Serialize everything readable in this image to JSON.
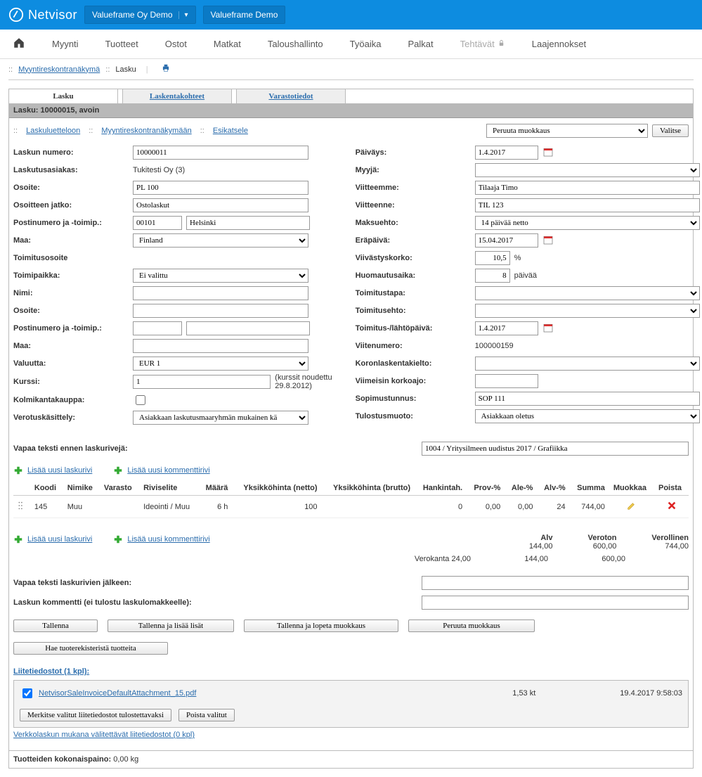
{
  "header": {
    "brand": "Netvisor",
    "company": "Valueframe Oy Demo",
    "env": "Valueframe Demo"
  },
  "menu": {
    "items": [
      "Myynti",
      "Tuotteet",
      "Ostot",
      "Matkat",
      "Taloushallinto",
      "Työaika",
      "Palkat",
      "Tehtävät",
      "Laajennokset"
    ]
  },
  "breadcrumb": {
    "link1": "Myyntireskontranäkymä",
    "sep": "::",
    "current": "Lasku"
  },
  "tabs": {
    "t1": "Lasku",
    "t2": "Laskentakohteet",
    "t3": "Varastotiedot"
  },
  "title": "Lasku: 10000015, avoin",
  "links": {
    "l1": "Laskuluetteloon",
    "l2": "Myyntireskontranäkymään",
    "l3": "Esikatsele"
  },
  "actions": {
    "select_default": "Peruuta muokkaus",
    "valitse": "Valitse"
  },
  "left": {
    "laskun_numero_l": "Laskun numero:",
    "laskun_numero_v": "10000011",
    "laskutusasiakas_l": "Laskutusasiakas:",
    "laskutusasiakas_v": "Tukitesti Oy (3)",
    "osoite_l": "Osoite:",
    "osoite_v": "PL 100",
    "osoitteen_jatko_l": "Osoitteen jatko:",
    "osoitteen_jatko_v": "Ostolaskut",
    "postinumero_l": "Postinumero ja -toimip.:",
    "postinro_v": "00101",
    "kaupunki_v": "Helsinki",
    "maa_l": "Maa:",
    "maa_v": "Finland",
    "toimosoite_l": "Toimitusosoite",
    "toimipaikka_l": "Toimipaikka:",
    "toimipaikka_v": "Ei valittu",
    "nimi_l": "Nimi:",
    "osoite2_l": "Osoite:",
    "postinumero2_l": "Postinumero ja -toimip.:",
    "maa2_l": "Maa:",
    "valuutta_l": "Valuutta:",
    "valuutta_v": "EUR 1",
    "kurssi_l": "Kurssi:",
    "kurssi_v": "1",
    "kurssi_note": "(kurssit noudettu 29.8.2012)",
    "kolmikanta_l": "Kolmikantakauppa:",
    "verotus_l": "Verotuskäsittely:",
    "verotus_v": "Asiakkaan laskutusmaaryhmän mukainen kä"
  },
  "right": {
    "paivays_l": "Päiväys:",
    "paivays_v": "1.4.2017",
    "myyja_l": "Myyjä:",
    "viitteemme_l": "Viitteemme:",
    "viitteemme_v": "Tilaaja Timo",
    "viitteenne_l": "Viitteenne:",
    "viitteenne_v": "TIL 123",
    "maksuehto_l": "Maksuehto:",
    "maksuehto_v": "14 päivää netto",
    "erapaiva_l": "Eräpäivä:",
    "erapaiva_v": "15.04.2017",
    "viivastyskorko_l": "Viivästyskorko:",
    "viivastyskorko_v": "10,5",
    "viivastyskorko_u": "%",
    "huomautusaika_l": "Huomautusaika:",
    "huomautusaika_v": "8",
    "huomautusaika_u": "päivää",
    "toimitustapa_l": "Toimitustapa:",
    "toimitusehto_l": "Toimitusehto:",
    "toimituspaiva_l": "Toimitus-/lähtöpäivä:",
    "toimituspaiva_v": "1.4.2017",
    "viitenumero_l": "Viitenumero:",
    "viitenumero_v": "100000159",
    "koronlaskenta_l": "Koronlaskentakielto:",
    "viimeisin_l": "Viimeisin korkoajo:",
    "sopimus_l": "Sopimustunnus:",
    "sopimus_v": "SOP 111",
    "tulostus_l": "Tulostusmuoto:",
    "tulostus_v": "Asiakkaan oletus"
  },
  "freetext": {
    "before_l": "Vapaa teksti ennen laskurivejä:",
    "before_v": "1004 / Yritysilmeen uudistus 2017 / Grafiikka",
    "after_l": "Vapaa teksti laskurivien jälkeen:",
    "comment_l": "Laskun kommentti (ei tulostu laskulomakkeelle):"
  },
  "addlinks": {
    "row": "Lisää uusi laskurivi",
    "comment": "Lisää uusi kommenttirivi"
  },
  "table": {
    "headers": {
      "koodi": "Koodi",
      "nimike": "Nimike",
      "varasto": "Varasto",
      "riviselite": "Riviselite",
      "maara": "Määrä",
      "yhn": "Yksikköhinta (netto)",
      "yhb": "Yksikköhinta (brutto)",
      "hankintah": "Hankintah.",
      "prov": "Prov-%",
      "ale": "Ale-%",
      "alv": "Alv-%",
      "summa": "Summa",
      "muokkaa": "Muokkaa",
      "poista": "Poista"
    },
    "row": {
      "koodi": "145",
      "nimike": "Muu",
      "varasto": "",
      "riviselite": "Ideointi / Muu",
      "maara": "6 h",
      "yhn": "100",
      "yhb": "",
      "hank": "0",
      "prov": "0,00",
      "ale": "0,00",
      "alv": "24",
      "summa": "744,00"
    }
  },
  "totals": {
    "alv_l": "Alv",
    "alv_v": "144,00",
    "veroton_l": "Veroton",
    "veroton_v": "600,00",
    "verollinen_l": "Verollinen",
    "verollinen_v": "744,00",
    "vat_line": "Verokanta 24,00",
    "vat_alv": "144,00",
    "vat_veroton": "600,00"
  },
  "buttons": {
    "b1": "Tallenna",
    "b2": "Tallenna ja lisää lisät",
    "b3": "Tallenna ja lopeta muokkaus",
    "b4": "Peruuta muokkaus",
    "b5": "Hae tuoterekisteristä tuotteita"
  },
  "attach": {
    "title": "Liitetiedostot (1 kpl):",
    "file": "NetvisorSaleInvoiceDefaultAttachment_15.pdf",
    "size": "1,53 kt",
    "date": "19.4.2017 9:58:03",
    "btn1": "Merkitse valitut liitetiedostot tulostettavaksi",
    "btn2": "Poista valitut",
    "elink": "Verkkolaskun mukana välitettävät liitetiedostot (0 kpl)"
  },
  "footer": {
    "weight_l": "Tuotteiden kokonaispaino:",
    "weight_v": "0,00 kg"
  }
}
